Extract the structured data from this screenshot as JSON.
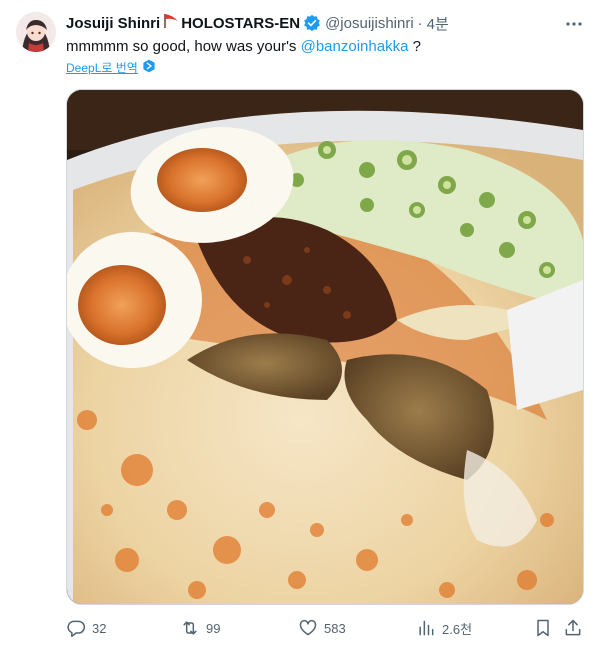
{
  "user": {
    "display_name": "Josuiji Shinri",
    "affiliation": "HOLOSTARS-EN",
    "handle": "@josuijishinri",
    "separator": "·",
    "time": "4분"
  },
  "tweet": {
    "text_before": "mmmmm so good, how was your's ",
    "mention": "@banzoinhakka",
    "text_after": " ?",
    "translate_label": "DeepL로 번역"
  },
  "metrics": {
    "replies": "32",
    "retweets": "99",
    "likes": "583",
    "views": "2.6천"
  },
  "colors": {
    "accent": "#1d9bf0",
    "muted": "#536471",
    "text": "#0f1419"
  },
  "icons": [
    "avatar",
    "flag-icon",
    "verified-icon",
    "more-icon",
    "deepl-icon",
    "reply-icon",
    "retweet-icon",
    "like-icon",
    "views-icon",
    "bookmark-icon",
    "share-icon"
  ]
}
